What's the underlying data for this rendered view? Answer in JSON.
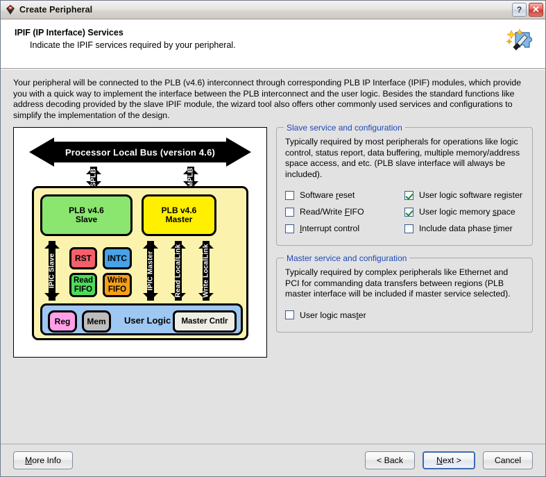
{
  "window": {
    "title": "Create Peripheral",
    "icon": "app-gem-icon",
    "help_label": "?",
    "close_label": "✕"
  },
  "header": {
    "title": "IPIF (IP Interface) Services",
    "subtitle": "Indicate the IPIF services required by your peripheral.",
    "icon": "wizard-wand-puzzle-icon"
  },
  "content": {
    "intro": "Your peripheral will be connected to the PLB (v4.6) interconnect through corresponding PLB IP Interface (IPIF) modules, which provide you with a quick way to implement the interface between the PLB interconnect and the user logic. Besides the standard functions like address decoding provided by the slave IPIF module, the wizard tool also offers other commonly used services and configurations to simplify the implementation of the design."
  },
  "diagram": {
    "bus_label": "Processor Local Bus (version 4.6)",
    "splb_label": "SPLB",
    "mplb_label": "MPLB",
    "plb_slave_line1": "PLB v4.6",
    "plb_slave_line2": "Slave",
    "plb_master_line1": "PLB v4.6",
    "plb_master_line2": "Master",
    "rst_label": "RST",
    "intc_label": "INTC",
    "read_fifo_line1": "Read",
    "read_fifo_line2": "FIFO",
    "write_fifo_line1": "Write",
    "write_fifo_line2": "FIFO",
    "ipic_slave_label": "IPIC Slave",
    "ipic_master_label": "IPIC Master",
    "read_locallink_label": "Read LocalLink",
    "write_locallink_label": "Write LocalLink",
    "user_logic_label": "User Logic",
    "reg_label": "Reg",
    "mem_label": "Mem",
    "master_cntlr_label": "Master Cntlr",
    "colors": {
      "panel_bg": "#fbf3ad",
      "slave": "#8ae66f",
      "master": "#ffef00",
      "rst": "#f4606a",
      "intc": "#47a2e8",
      "read_fifo": "#4ddb5c",
      "write_fifo": "#f59e17",
      "user_logic": "#9ec7f2",
      "reg": "#ffa0e8",
      "mem": "#bdbdbd",
      "master_cntlr": "#efeee4"
    }
  },
  "slave_group": {
    "title": "Slave service and configuration",
    "description": "Typically required by most peripherals for operations like logic control, status report, data buffering, multiple memory/address space access, and etc. (PLB slave interface will always be included).",
    "left_options": [
      {
        "label_before": "Software ",
        "mnemonic": "r",
        "label_after": "eset",
        "checked": false
      },
      {
        "label_before": "Read/Write ",
        "mnemonic": "F",
        "label_after": "IFO",
        "checked": false
      },
      {
        "label_before": "",
        "mnemonic": "I",
        "label_after": "nterrupt control",
        "checked": false
      }
    ],
    "right_options": [
      {
        "label_before": "User logic software re",
        "mnemonic": "g",
        "label_after": "ister",
        "checked": true
      },
      {
        "label_before": "User logic memory ",
        "mnemonic": "s",
        "label_after": "pace",
        "checked": true
      },
      {
        "label_before": "Include data phase ",
        "mnemonic": "t",
        "label_after": "imer",
        "checked": false
      }
    ]
  },
  "master_group": {
    "title": "Master service and configuration",
    "description": "Typically required by complex peripherals like Ethernet and PCI for commanding data transfers between regions (PLB master interface will be included if master service selected).",
    "options": [
      {
        "label_before": "User logic mas",
        "mnemonic": "t",
        "label_after": "er",
        "checked": false
      }
    ]
  },
  "footer": {
    "more_info_before": "",
    "more_info_mnemonic": "M",
    "more_info_after": "ore Info",
    "back_label": "< Back",
    "next_before": "",
    "next_mnemonic": "N",
    "next_after": "ext >",
    "cancel_label": "Cancel",
    "accent": "#3c6ab5"
  }
}
